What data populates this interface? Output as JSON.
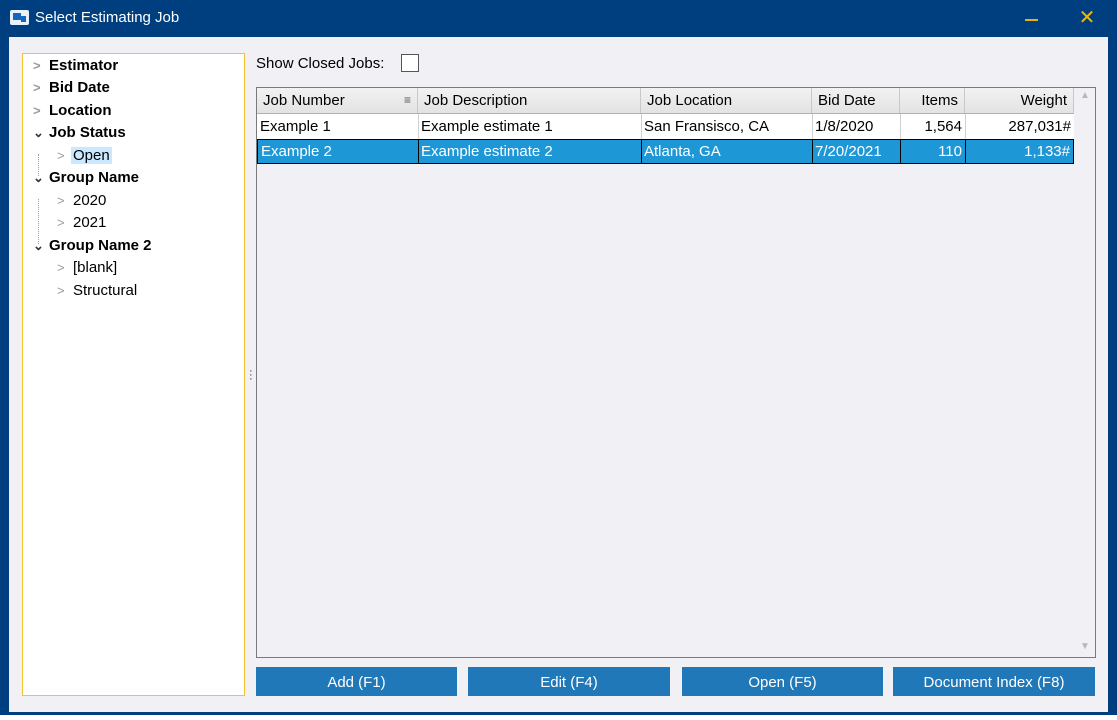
{
  "window": {
    "title": "Select Estimating Job",
    "close_glyph": "✕",
    "icon": "app-icon",
    "minimize_icon": "minimize-icon",
    "close_icon": "close-icon",
    "accent_color": "#003f7f",
    "selection_color": "#1e97d6",
    "button_color": "#2178b8",
    "tree_border_color": "#f4c430"
  },
  "tree": {
    "items": [
      {
        "label": "Estimator",
        "expanded": false
      },
      {
        "label": "Bid Date",
        "expanded": false
      },
      {
        "label": "Location",
        "expanded": false
      },
      {
        "label": "Job Status",
        "expanded": true
      },
      {
        "label": "Open",
        "selected": true
      },
      {
        "label": "Group Name",
        "expanded": true
      },
      {
        "label": "2020"
      },
      {
        "label": "2021"
      },
      {
        "label": "Group Name 2",
        "expanded": true
      },
      {
        "label": "[blank]"
      },
      {
        "label": "Structural"
      }
    ]
  },
  "filters": {
    "show_closed_label": "Show Closed Jobs:",
    "show_closed_checked": false
  },
  "grid": {
    "columns": [
      "Job Number",
      "Job Description",
      "Job Location",
      "Bid Date",
      "Items",
      "Weight"
    ],
    "sorted_column": "Job Number",
    "rows": [
      {
        "job_number": "Example 1",
        "description": "Example estimate 1",
        "location": "San Fransisco, CA",
        "bid_date": "1/8/2020",
        "items": "1,564",
        "weight": "287,031#",
        "selected": false
      },
      {
        "job_number": "Example 2",
        "description": "Example estimate 2",
        "location": "Atlanta, GA",
        "bid_date": "7/20/2021",
        "items": "110",
        "weight": "1,133#",
        "selected": true
      }
    ]
  },
  "buttons": {
    "add": "Add (F1)",
    "edit": "Edit (F4)",
    "open": "Open (F5)",
    "document_index": "Document Index (F8)"
  }
}
